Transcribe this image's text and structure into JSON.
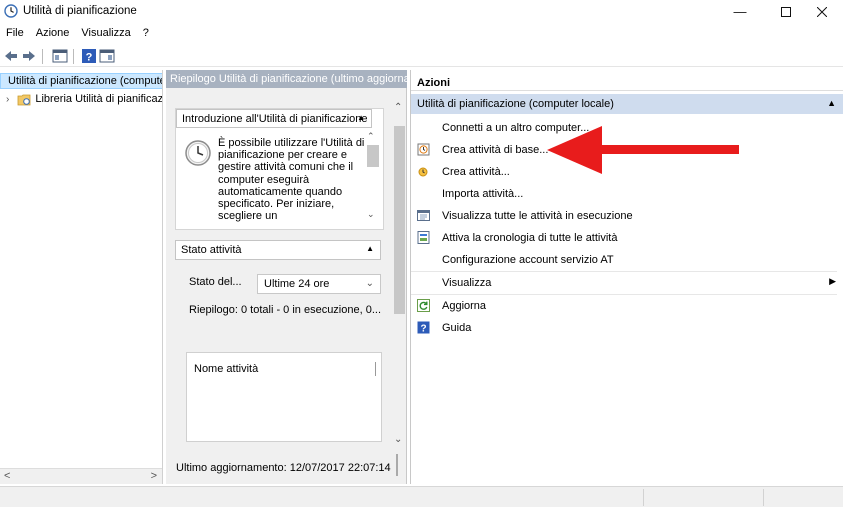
{
  "window": {
    "title": "Utilità di pianificazione",
    "minimize": "—",
    "maximize": "☐",
    "close": "✕"
  },
  "menu": [
    "File",
    "Azione",
    "Visualizza",
    "?"
  ],
  "tree": {
    "root": "Utilità di pianificazione (computer locale)",
    "child": "Libreria Utilità di pianificazione"
  },
  "middle": {
    "header": "Riepilogo Utilità di pianificazione (ultimo aggiornamento:",
    "intro": {
      "title": "Introduzione all'Utilità di pianificazione",
      "text": "È possibile utilizzare l'Utilità di pianificazione per creare e gestire attività comuni che il computer eseguirà automaticamente quando specificato. Per iniziare, scegliere un"
    },
    "status": {
      "title": "Stato attività",
      "status_label": "Stato del...",
      "select_value": "Ultime 24 ore",
      "summary": "Riepilogo: 0 totali - 0 in esecuzione, 0...",
      "column": "Nome attività"
    },
    "last_update": "Ultimo aggiornamento: 12/07/2017 22:07:14"
  },
  "actions": {
    "title": "Azioni",
    "group": "Utilità di pianificazione (computer locale)",
    "items": [
      {
        "label": "Connetti a un altro computer...",
        "icon": "none"
      },
      {
        "label": "Crea attività di base...",
        "icon": "basic-task-icon"
      },
      {
        "label": "Crea attività...",
        "icon": "create-task-icon"
      },
      {
        "label": "Importa attività...",
        "icon": "none"
      },
      {
        "label": "Visualizza tutte le attività in esecuzione",
        "icon": "running-tasks-icon"
      },
      {
        "label": "Attiva la cronologia di tutte le attività",
        "icon": "history-icon"
      },
      {
        "label": "Configurazione account servizio AT",
        "icon": "none"
      },
      {
        "label": "Visualizza",
        "icon": "none"
      },
      {
        "label": "Aggiorna",
        "icon": "refresh-icon"
      },
      {
        "label": "Guida",
        "icon": "help-icon"
      }
    ]
  },
  "colors": {
    "selection": "#cce8ff",
    "pane_header": "#a8b2c0",
    "actions_group": "#cfdcee",
    "arrow": "#e81c1c"
  }
}
